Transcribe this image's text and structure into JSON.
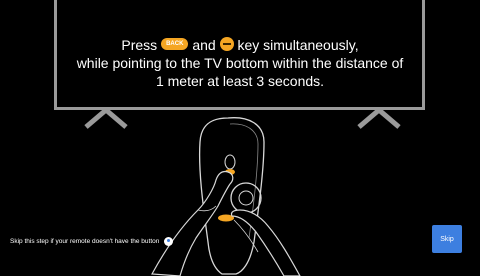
{
  "instruction": {
    "press": "Press",
    "back_key_label": "BACK",
    "and": "and",
    "after_keys": "key simultaneously,",
    "line2": "while pointing to the TV bottom within the distance of",
    "line3": "1 meter at least 3 seconds."
  },
  "footer": {
    "skip_note": "Skip this step if your remote doesn't have the button",
    "skip_button": "Skip"
  },
  "colors": {
    "background": "#000000",
    "key_highlight": "#f5a623",
    "accent": "#3d7fe0",
    "outline": "#9a9a9a"
  }
}
